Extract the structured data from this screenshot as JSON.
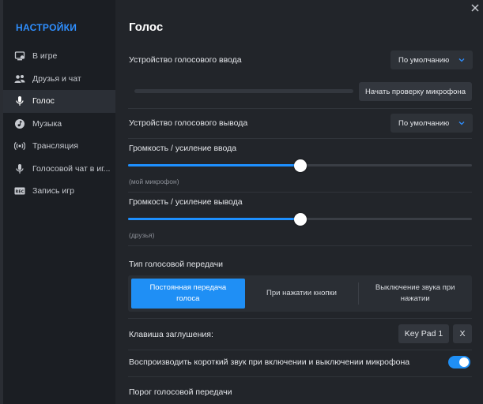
{
  "sidebar": {
    "title": "НАСТРОЙКИ",
    "items": [
      {
        "label": "В игре",
        "icon": "gamepad-icon",
        "active": false
      },
      {
        "label": "Друзья и чат",
        "icon": "friends-icon",
        "active": false
      },
      {
        "label": "Голос",
        "icon": "microphone-icon",
        "active": true
      },
      {
        "label": "Музыка",
        "icon": "music-icon",
        "active": false
      },
      {
        "label": "Трансляция",
        "icon": "broadcast-icon",
        "active": false
      },
      {
        "label": "Голосовой чат в иг...",
        "icon": "microphone-icon",
        "active": false
      },
      {
        "label": "Запись игр",
        "icon": "record-icon",
        "active": false
      }
    ]
  },
  "main": {
    "title": "Голос",
    "input_device": {
      "label": "Устройство голосового ввода",
      "value": "По умолчанию"
    },
    "mic_test_button": "Начать проверку микрофона",
    "output_device": {
      "label": "Устройство голосового вывода",
      "value": "По умолчанию"
    },
    "input_volume": {
      "label": "Громкость / усиление ввода",
      "sublabel": "(мой микрофон)",
      "value_percent": 50
    },
    "output_volume": {
      "label": "Громкость / усиление вывода",
      "sublabel": "(друзья)",
      "value_percent": 50
    },
    "transmission": {
      "label": "Тип голосовой передачи",
      "options": [
        {
          "line1": "Постоянная передача",
          "line2": "голоса",
          "active": true
        },
        {
          "line1": "При нажатии кнопки",
          "line2": "",
          "active": false
        },
        {
          "line1": "Выключение звука при",
          "line2": "нажатии",
          "active": false
        }
      ]
    },
    "mute_key": {
      "label": "Клавиша заглушения:",
      "key": "Key Pad 1",
      "clear": "X"
    },
    "play_sound": {
      "label": "Воспроизводить короткий звук при включении и выключении микрофона",
      "enabled": true
    },
    "threshold": {
      "label": "Порог голосовой передачи"
    }
  },
  "colors": {
    "accent": "#1f8ff5",
    "sidebar_title": "#2f8fff"
  }
}
